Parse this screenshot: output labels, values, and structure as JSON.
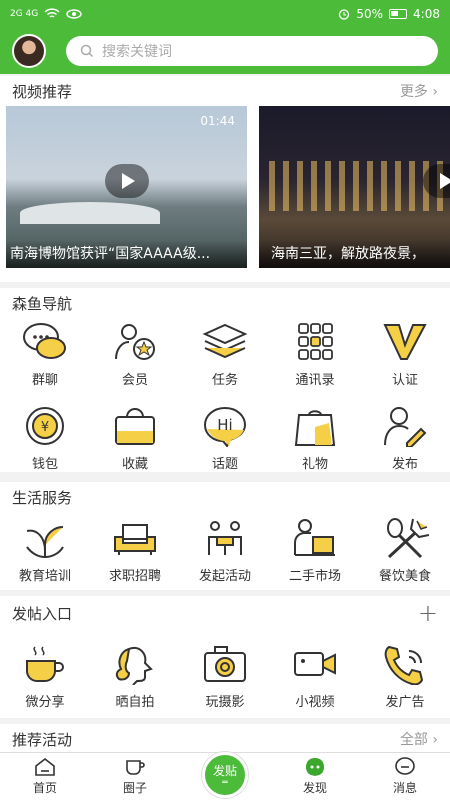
{
  "status": {
    "signal_left": "2G 4G",
    "battery": "50%",
    "time": "4:08"
  },
  "search": {
    "placeholder": "搜索关键词"
  },
  "videos": {
    "title": "视频推荐",
    "more": "更多",
    "items": [
      {
        "duration": "01:44",
        "caption": "南海博物馆获评“国家AAAA级..."
      },
      {
        "duration": "",
        "caption": "海南三亚，解放路夜景，"
      }
    ]
  },
  "nav": {
    "title": "森鱼导航",
    "items": [
      {
        "label": "群聊",
        "icon": "chat-bubbles-icon"
      },
      {
        "label": "会员",
        "icon": "member-star-icon"
      },
      {
        "label": "任务",
        "icon": "layers-icon"
      },
      {
        "label": "通讯录",
        "icon": "keypad-icon"
      },
      {
        "label": "认证",
        "icon": "verified-v-icon"
      },
      {
        "label": "钱包",
        "icon": "wallet-coin-icon"
      },
      {
        "label": "收藏",
        "icon": "basket-icon"
      },
      {
        "label": "话题",
        "icon": "hi-bubble-icon"
      },
      {
        "label": "礼物",
        "icon": "gift-bag-icon"
      },
      {
        "label": "发布",
        "icon": "user-edit-icon"
      }
    ]
  },
  "life": {
    "title": "生活服务",
    "items": [
      {
        "label": "教育培训",
        "icon": "education-icon"
      },
      {
        "label": "求职招聘",
        "icon": "sofa-job-icon"
      },
      {
        "label": "发起活动",
        "icon": "meeting-icon"
      },
      {
        "label": "二手市场",
        "icon": "delivery-icon"
      },
      {
        "label": "餐饮美食",
        "icon": "cutlery-icon"
      }
    ]
  },
  "post": {
    "title": "发帖入口",
    "plus": "+",
    "items": [
      {
        "label": "微分享",
        "icon": "coffee-icon"
      },
      {
        "label": "晒自拍",
        "icon": "selfie-icon"
      },
      {
        "label": "玩摄影",
        "icon": "camera-icon"
      },
      {
        "label": "小视频",
        "icon": "video-camera-icon"
      },
      {
        "label": "发广告",
        "icon": "phone-ad-icon"
      }
    ]
  },
  "activities": {
    "title": "推荐活动",
    "more": "全部"
  },
  "tabbar": {
    "items": [
      {
        "label": "首页",
        "icon": "home-icon"
      },
      {
        "label": "圈子",
        "icon": "cup-icon"
      },
      {
        "label": "发贴",
        "icon": "post-icon"
      },
      {
        "label": "发现",
        "icon": "discover-icon"
      },
      {
        "label": "消息",
        "icon": "message-icon"
      }
    ]
  },
  "colors": {
    "primary": "#4cbb3a",
    "accent": "#f5d046"
  }
}
